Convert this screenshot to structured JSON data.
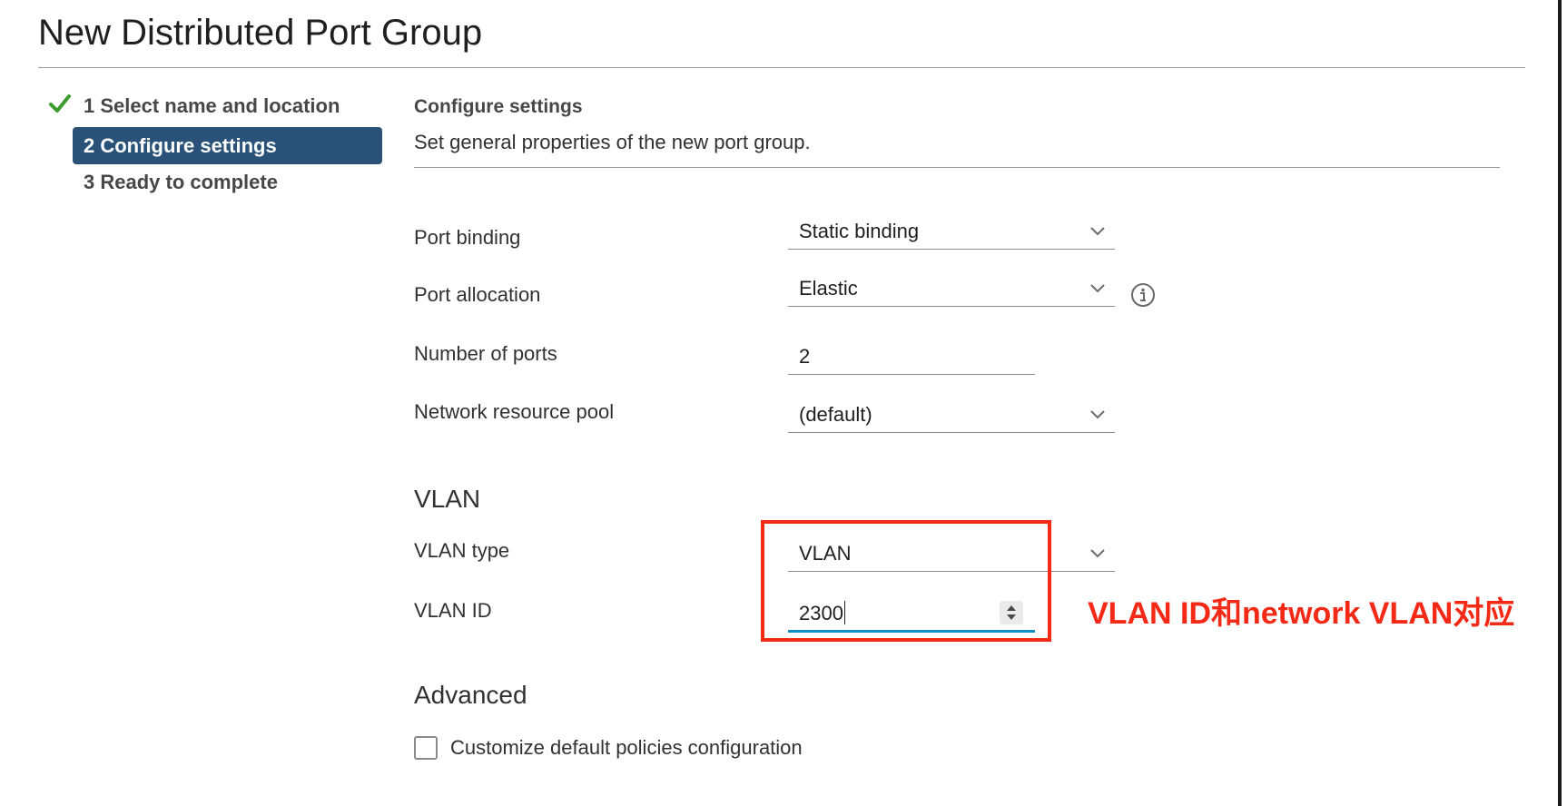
{
  "dialog": {
    "title": "New Distributed Port Group"
  },
  "steps": [
    {
      "label": "1 Select name and location",
      "state": "completed",
      "icon": "check-icon"
    },
    {
      "label": "2 Configure settings",
      "state": "active"
    },
    {
      "label": "3 Ready to complete",
      "state": "pending"
    }
  ],
  "section": {
    "title": "Configure settings",
    "description": "Set general properties of the new port group."
  },
  "fields": {
    "port_binding": {
      "label": "Port binding",
      "value": "Static binding"
    },
    "port_allocation": {
      "label": "Port allocation",
      "value": "Elastic",
      "icon": "info-icon"
    },
    "number_of_ports": {
      "label": "Number of ports",
      "value": "2"
    },
    "network_resource_pool": {
      "label": "Network resource pool",
      "value": "(default)"
    }
  },
  "vlan": {
    "heading": "VLAN",
    "type": {
      "label": "VLAN type",
      "value": "VLAN"
    },
    "id": {
      "label": "VLAN ID",
      "value": "2300"
    }
  },
  "advanced": {
    "heading": "Advanced",
    "customize_label": "Customize default policies configuration",
    "customize_checked": false
  },
  "annotation": {
    "text": "VLAN ID和network VLAN对应"
  },
  "colors": {
    "accent": "#2a5278",
    "check": "#3c9a2e",
    "annotation": "#f52a16",
    "focus_underline": "#0f8fc4"
  }
}
